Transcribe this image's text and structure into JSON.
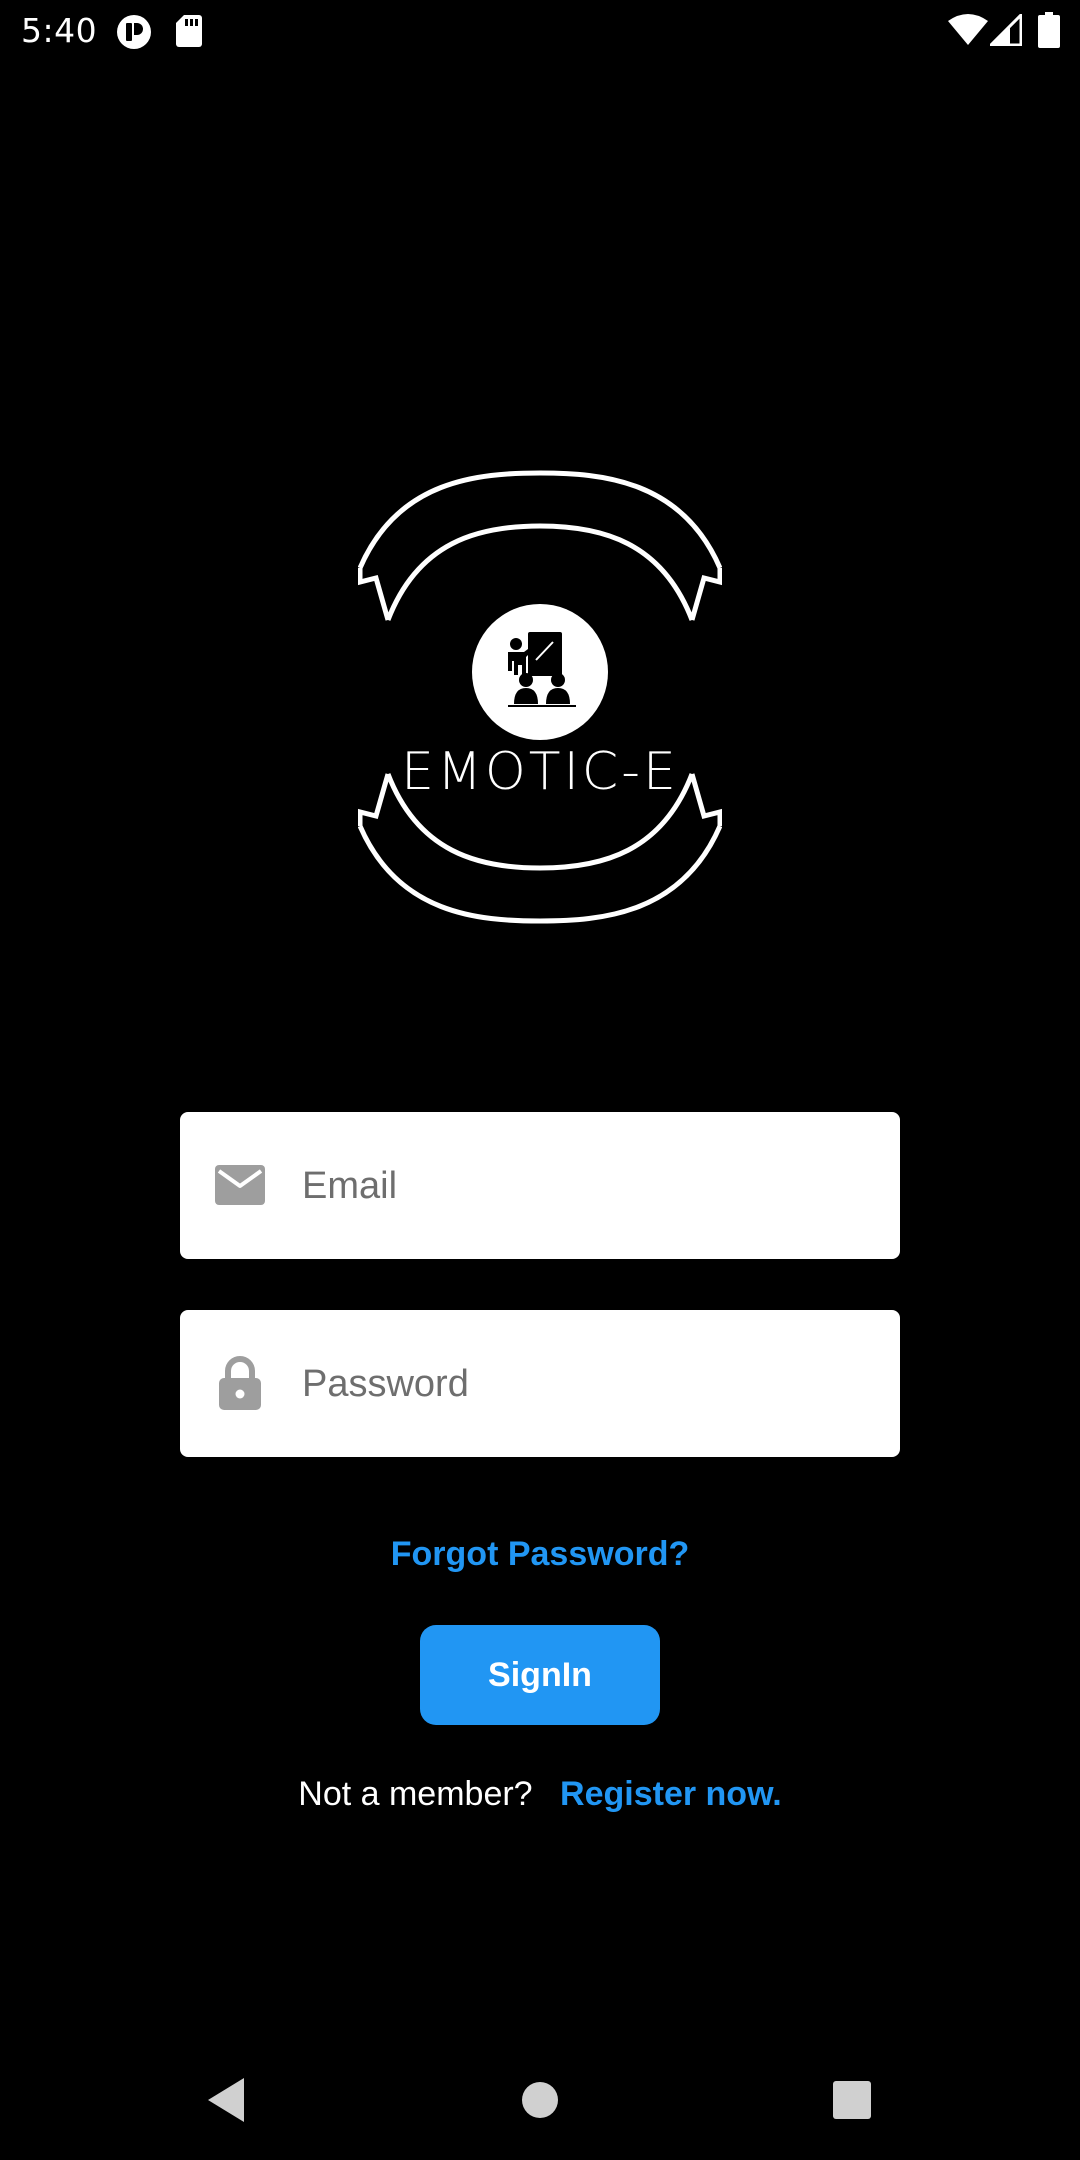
{
  "status_bar": {
    "time": "5:40",
    "icons": [
      "app-notification-icon",
      "sd-card-icon",
      "wifi-icon",
      "cellular-signal-icon",
      "battery-icon"
    ]
  },
  "logo": {
    "name": "EMOTIC-E",
    "icon": "teacher-classroom-icon"
  },
  "form": {
    "email": {
      "placeholder": "Email",
      "value": "",
      "icon": "mail-icon"
    },
    "password": {
      "placeholder": "Password",
      "value": "",
      "icon": "lock-icon"
    },
    "forgot_label": "Forgot Password?",
    "signin_label": "SignIn",
    "register_prompt": "Not a member?",
    "register_link": "Register now."
  },
  "nav_bar": {
    "icons": [
      "back-icon",
      "home-icon",
      "recents-icon"
    ]
  },
  "colors": {
    "background": "#000000",
    "accent": "#2196f3",
    "input_background": "#ffffff",
    "input_icon": "#9e9e9e"
  }
}
